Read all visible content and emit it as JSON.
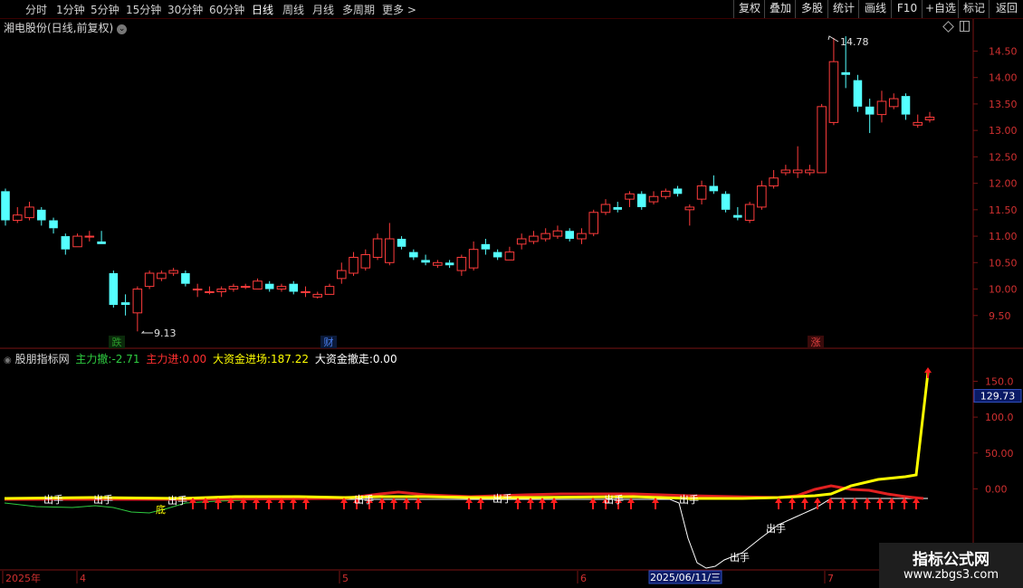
{
  "toolbar": {
    "periods": [
      "分时",
      "1分钟",
      "5分钟",
      "15分钟",
      "30分钟",
      "60分钟",
      "日线",
      "周线",
      "月线",
      "多周期",
      "更多 >"
    ],
    "active_period": "日线",
    "buttons": [
      "复权",
      "叠加",
      "多股",
      "统计",
      "画线",
      "F10",
      "+自选",
      "标记",
      "返回"
    ]
  },
  "main_panel": {
    "title": "湘电股份(日线,前复权)",
    "price_ticks": [
      "14.50",
      "14.00",
      "13.50",
      "13.00",
      "12.50",
      "12.00",
      "11.50",
      "11.00",
      "10.50",
      "10.00",
      "9.50"
    ],
    "high_label": "14.78",
    "low_label": "9.13",
    "markers": [
      {
        "text": "跌",
        "color": "#2a9a2a"
      },
      {
        "text": "财",
        "color": "#1e4fbf"
      },
      {
        "text": "涨",
        "color": "#b02020"
      }
    ]
  },
  "indicator_panel": {
    "name": "股朋指标网",
    "values": [
      {
        "label": "主力撤:",
        "value": "-2.71",
        "color": "#2ecc40"
      },
      {
        "label": "主力进:",
        "value": "0.00",
        "color": "#ff3030"
      },
      {
        "label": "大资金进场:",
        "value": "187.22",
        "color": "#ffff00"
      },
      {
        "label": "大资金撤走:",
        "value": "0.00",
        "color": "#ffffff"
      }
    ],
    "ticks": [
      "150.0",
      "100.0",
      "50.00",
      "0.00"
    ],
    "current_value": "129.73",
    "signal_label": "出手",
    "bottom_label": "底"
  },
  "time_axis": {
    "labels": [
      "2025年",
      "4",
      "5",
      "6",
      "7"
    ],
    "cursor_date": "2025/06/11/三"
  },
  "chart_data": {
    "type": "candlestick",
    "y_range": [
      9.0,
      14.85
    ],
    "candles": [
      [
        11.85,
        11.3,
        11.9,
        11.2
      ],
      [
        11.3,
        11.4,
        11.55,
        11.25
      ],
      [
        11.35,
        11.55,
        11.65,
        11.3
      ],
      [
        11.5,
        11.3,
        11.55,
        11.2
      ],
      [
        11.3,
        11.15,
        11.35,
        11.05
      ],
      [
        11.0,
        10.75,
        11.05,
        10.65
      ],
      [
        10.8,
        11.0,
        11.05,
        10.8
      ],
      [
        11.0,
        11.0,
        11.1,
        10.9
      ],
      [
        10.9,
        10.85,
        11.1,
        10.85
      ],
      [
        10.3,
        9.7,
        10.35,
        9.65
      ],
      [
        9.75,
        9.7,
        9.9,
        9.5
      ],
      [
        9.55,
        10.0,
        10.05,
        9.2
      ],
      [
        10.05,
        10.3,
        10.35,
        10.0
      ],
      [
        10.2,
        10.3,
        10.35,
        10.15
      ],
      [
        10.3,
        10.35,
        10.4,
        10.25
      ],
      [
        10.3,
        10.1,
        10.35,
        10.05
      ],
      [
        10.0,
        10.0,
        10.1,
        9.85
      ],
      [
        9.95,
        9.95,
        10.05,
        9.9
      ],
      [
        9.95,
        10.0,
        10.05,
        9.85
      ],
      [
        10.0,
        10.05,
        10.1,
        9.95
      ],
      [
        10.05,
        10.05,
        10.1,
        10.0
      ],
      [
        10.0,
        10.15,
        10.2,
        10.0
      ],
      [
        10.1,
        10.0,
        10.15,
        9.95
      ],
      [
        10.0,
        10.05,
        10.1,
        9.95
      ],
      [
        10.1,
        9.95,
        10.15,
        9.9
      ],
      [
        9.95,
        9.95,
        10.05,
        9.85
      ],
      [
        9.85,
        9.9,
        9.95,
        9.82
      ],
      [
        9.9,
        10.05,
        10.1,
        9.9
      ],
      [
        10.2,
        10.35,
        10.5,
        10.1
      ],
      [
        10.3,
        10.6,
        10.7,
        10.25
      ],
      [
        10.4,
        10.65,
        10.75,
        10.35
      ],
      [
        10.6,
        10.95,
        11.05,
        10.55
      ],
      [
        10.5,
        10.95,
        11.25,
        10.45
      ],
      [
        10.95,
        10.8,
        11.0,
        10.75
      ],
      [
        10.7,
        10.6,
        10.75,
        10.55
      ],
      [
        10.55,
        10.5,
        10.65,
        10.45
      ],
      [
        10.45,
        10.5,
        10.55,
        10.4
      ],
      [
        10.5,
        10.45,
        10.55,
        10.4
      ],
      [
        10.35,
        10.6,
        10.65,
        10.25
      ],
      [
        10.4,
        10.75,
        10.9,
        10.35
      ],
      [
        10.85,
        10.75,
        10.95,
        10.65
      ],
      [
        10.7,
        10.6,
        10.75,
        10.55
      ],
      [
        10.55,
        10.7,
        10.8,
        10.55
      ],
      [
        10.85,
        10.95,
        11.05,
        10.75
      ],
      [
        10.9,
        11.0,
        11.1,
        10.85
      ],
      [
        10.95,
        11.05,
        11.15,
        10.9
      ],
      [
        11.0,
        11.1,
        11.2,
        10.95
      ],
      [
        11.1,
        10.95,
        11.15,
        10.9
      ],
      [
        10.95,
        11.05,
        11.15,
        10.85
      ],
      [
        11.05,
        11.45,
        11.5,
        11.0
      ],
      [
        11.45,
        11.6,
        11.7,
        11.4
      ],
      [
        11.55,
        11.5,
        11.65,
        11.45
      ],
      [
        11.7,
        11.8,
        11.85,
        11.55
      ],
      [
        11.8,
        11.55,
        11.85,
        11.5
      ],
      [
        11.65,
        11.75,
        11.85,
        11.6
      ],
      [
        11.75,
        11.85,
        11.9,
        11.7
      ],
      [
        11.9,
        11.8,
        11.95,
        11.75
      ],
      [
        11.5,
        11.55,
        11.6,
        11.2
      ],
      [
        11.7,
        11.95,
        12.05,
        11.6
      ],
      [
        11.95,
        11.85,
        12.15,
        11.8
      ],
      [
        11.8,
        11.5,
        11.85,
        11.45
      ],
      [
        11.4,
        11.35,
        11.55,
        11.3
      ],
      [
        11.3,
        11.6,
        11.65,
        11.25
      ],
      [
        11.55,
        11.95,
        12.05,
        11.5
      ],
      [
        11.95,
        12.1,
        12.25,
        11.9
      ],
      [
        12.2,
        12.25,
        12.35,
        12.15
      ],
      [
        12.2,
        12.25,
        12.7,
        12.1
      ],
      [
        12.2,
        12.25,
        12.35,
        12.15
      ],
      [
        12.2,
        13.45,
        13.5,
        12.2
      ],
      [
        13.15,
        14.3,
        14.75,
        13.1
      ],
      [
        14.1,
        14.05,
        14.78,
        13.8
      ],
      [
        13.95,
        13.45,
        14.05,
        13.35
      ],
      [
        13.45,
        13.3,
        13.6,
        12.95
      ],
      [
        13.3,
        13.55,
        13.75,
        13.15
      ],
      [
        13.45,
        13.6,
        13.7,
        13.4
      ],
      [
        13.65,
        13.3,
        13.7,
        13.2
      ],
      [
        13.1,
        13.15,
        13.3,
        13.05
      ],
      [
        13.2,
        13.25,
        13.35,
        13.15
      ]
    ],
    "indicator_y_range": [
      -113,
      196
    ]
  }
}
